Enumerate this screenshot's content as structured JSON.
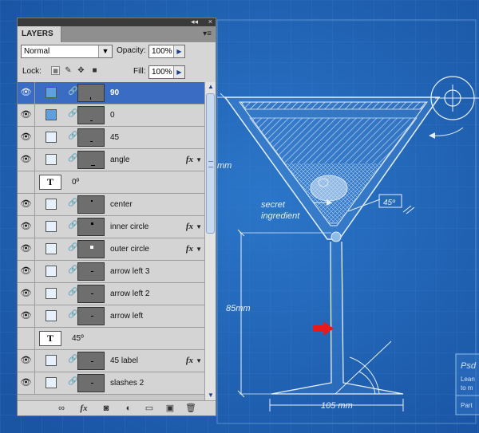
{
  "panel": {
    "tab_label": "LAYERS",
    "topbar_collapse": "◂◂",
    "topbar_close": "×",
    "menu_button": "▾≡",
    "blend_mode": "Normal",
    "opacity_label": "Opacity:",
    "opacity_value": "100%",
    "lock_label": "Lock:",
    "fill_label": "Fill:",
    "fill_value": "100%"
  },
  "layers": [
    {
      "name": "90",
      "type": "shape",
      "selected": true,
      "mask": "blue",
      "fx": false
    },
    {
      "name": "0",
      "type": "shape",
      "selected": false,
      "mask": "blue",
      "fx": false
    },
    {
      "name": "45",
      "type": "shape",
      "selected": false,
      "mask": "white",
      "fx": false
    },
    {
      "name": "angle",
      "type": "shape",
      "selected": false,
      "mask": "white",
      "fx": true
    },
    {
      "name": "0º",
      "type": "text"
    },
    {
      "name": "center",
      "type": "shape",
      "selected": false,
      "mask": "white",
      "fx": false
    },
    {
      "name": "inner circle",
      "type": "shape",
      "selected": false,
      "mask": "white",
      "fx": true
    },
    {
      "name": "outer circle",
      "type": "shape",
      "selected": false,
      "mask": "white",
      "fx": true
    },
    {
      "name": "arrow left 3",
      "type": "shape",
      "selected": false,
      "mask": "white",
      "fx": false
    },
    {
      "name": "arrow left 2",
      "type": "shape",
      "selected": false,
      "mask": "white",
      "fx": false
    },
    {
      "name": "arrow left",
      "type": "shape",
      "selected": false,
      "mask": "white",
      "fx": false
    },
    {
      "name": "45º",
      "type": "text"
    },
    {
      "name": "45 label",
      "type": "shape",
      "selected": false,
      "mask": "white",
      "fx": true
    },
    {
      "name": "slashes 2",
      "type": "shape",
      "selected": false,
      "mask": "white",
      "fx": false
    }
  ],
  "blueprint": {
    "dim_mm": "mm",
    "secret_line1": "secret",
    "secret_line2": "ingredient",
    "angle_label": "45º",
    "height_label": "85mm",
    "width_label": "105 mm",
    "side_title": "Psd",
    "side_line1": "Lean",
    "side_line2": "to m",
    "side_part": "Part"
  },
  "icons": {
    "eye": "eye-icon",
    "chain": "link-icon",
    "fx": "fx-icon",
    "text_layer": "text-layer-icon"
  },
  "colors": {
    "canvas": "#1d5fb0",
    "selection": "#3a6cc4",
    "mask_blue": "#5fa0de",
    "red_arrow": "#e8191b"
  }
}
